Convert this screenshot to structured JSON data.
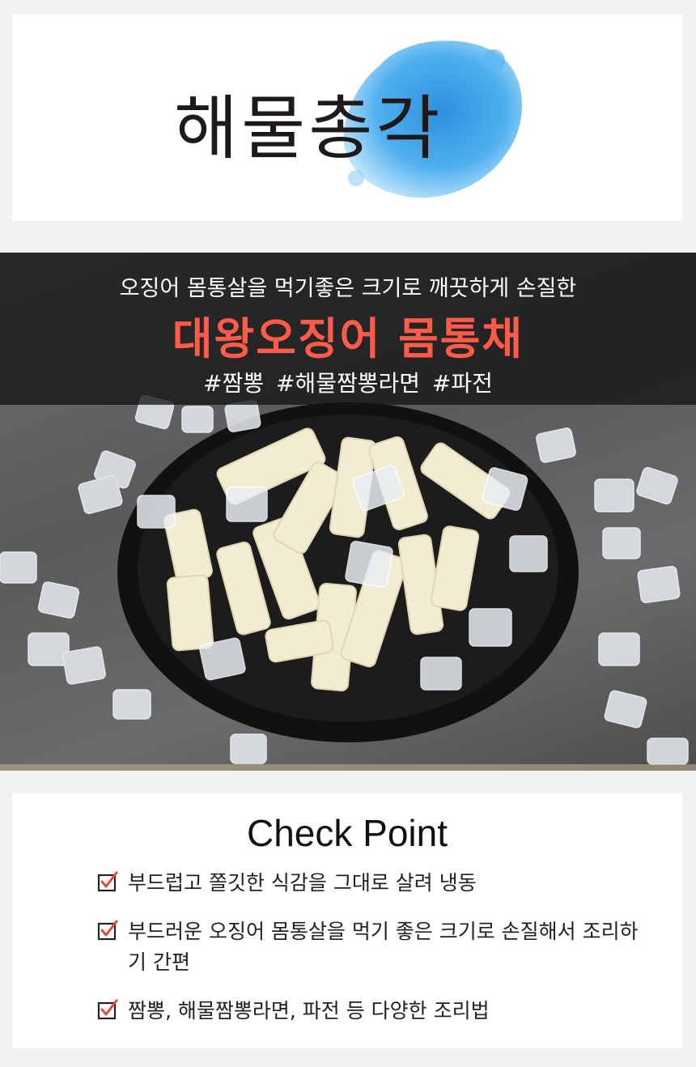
{
  "logo": {
    "text": "해물총각"
  },
  "hero": {
    "subtitle": "오징어 몸통살을 먹기좋은 크기로 깨끗하게 손질한",
    "title": "대왕오징어 몸통채",
    "tags": "#짬뽕  #해물짬뽕라면  #파전"
  },
  "check_point": {
    "title": "Check Point",
    "items": [
      {
        "text": "부드럽고 쫄깃한 식감을 그대로 살려 냉동"
      },
      {
        "text": "부드러운 오징어 몸통살을 먹기 좋은 크기로 손질해서 조리하기 간편"
      },
      {
        "text": "짬뽕, 해물짬뽕라면, 파전 등 다양한 조리법"
      }
    ]
  },
  "colors": {
    "accent": "#ff5a4a",
    "splash": "#3fa0e6",
    "check": "#e8483c"
  }
}
